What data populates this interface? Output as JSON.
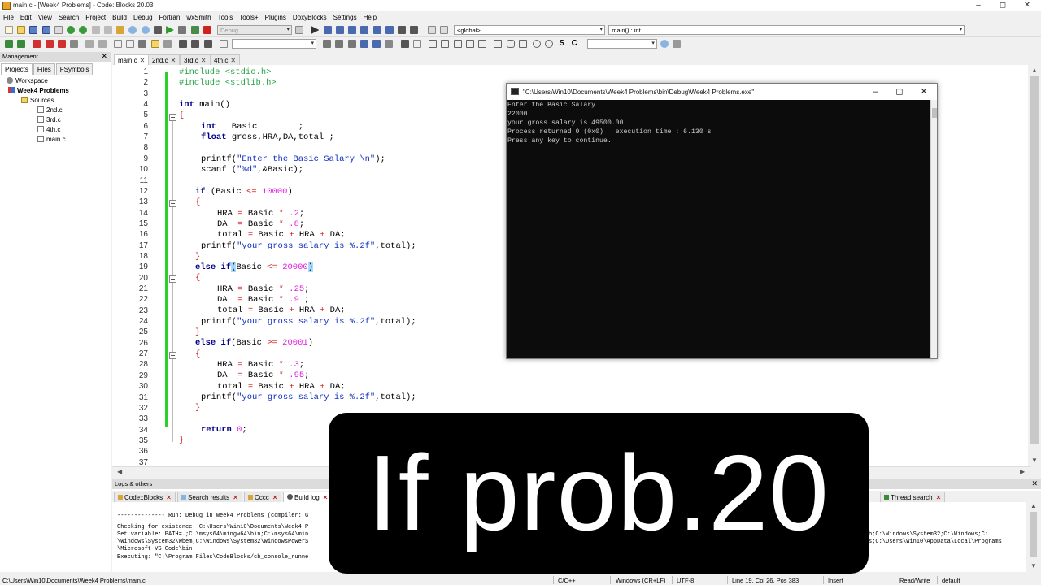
{
  "window": {
    "title": "main.c - [Week4 Problems] - Code::Blocks 20.03"
  },
  "menubar": [
    "File",
    "Edit",
    "View",
    "Search",
    "Project",
    "Build",
    "Debug",
    "Fortran",
    "wxSmith",
    "Tools",
    "Tools+",
    "Plugins",
    "DoxyBlocks",
    "Settings",
    "Help"
  ],
  "toolbar": {
    "build_target": "Debug",
    "scope": "<global>",
    "function": "main() : int"
  },
  "management": {
    "title": "Management",
    "tabs": [
      "Projects",
      "Files",
      "FSymbols"
    ],
    "workspace": "Workspace",
    "project": "Week4 Problems",
    "sources": "Sources",
    "files": [
      "2nd.c",
      "3rd.c",
      "4th.c",
      "main.c"
    ]
  },
  "editor": {
    "tabs": [
      {
        "label": "main.c",
        "active": true
      },
      {
        "label": "2nd.c",
        "active": false
      },
      {
        "label": "3rd.c",
        "active": false
      },
      {
        "label": "4th.c",
        "active": false
      }
    ],
    "line_numbers": [
      1,
      2,
      3,
      4,
      5,
      6,
      7,
      8,
      9,
      10,
      11,
      12,
      13,
      14,
      15,
      16,
      17,
      18,
      19,
      20,
      21,
      22,
      23,
      24,
      25,
      26,
      27,
      28,
      29,
      30,
      31,
      32,
      33,
      34,
      35,
      36,
      37
    ],
    "code": {
      "l1": "#include <stdio.h>",
      "l2": "#include <stdlib.h>",
      "l4a": "int",
      "l4b": " main()",
      "l5": "{",
      "l6a": "int",
      "l6b": "   Basic        ;",
      "l7a": "float",
      "l7b": " gross,HRA,DA,total ;",
      "l9a": "printf(",
      "l9b": "\"Enter the Basic Salary \\n\"",
      "l9c": ");",
      "l10a": "scanf (",
      "l10b": "\"%d\"",
      "l10c": ",&Basic);",
      "l12a": "if",
      "l12b": " (Basic ",
      "l12c": "<=",
      "l12d": " ",
      "l12e": "10000",
      "l12f": ")",
      "l13": "{",
      "l14a": "HRA ",
      "l14b": "=",
      "l14c": " Basic ",
      "l14d": "*",
      "l14e": " ",
      "l14f": ".2",
      "l14g": ";",
      "l15a": "DA  ",
      "l15b": "=",
      "l15c": " Basic ",
      "l15d": "*",
      "l15e": " ",
      "l15f": ".8",
      "l15g": ";",
      "l16a": "total ",
      "l16b": "=",
      "l16c": " Basic ",
      "l16d": "+",
      "l16e": " HRA ",
      "l16f": "+",
      "l16g": " DA;",
      "l17a": "printf(",
      "l17b": "\"your gross salary is %.2f\"",
      "l17c": ",total);",
      "l18": "}",
      "l19a": "else",
      "l19b": " ",
      "l19c": "if",
      "l19d": "(",
      "l19e": "Basic ",
      "l19f": "<=",
      "l19g": " ",
      "l19h": "20000",
      "l19i": ")",
      "l20": "{",
      "l21a": "HRA ",
      "l21b": "=",
      "l21c": " Basic ",
      "l21d": "*",
      "l21e": " ",
      "l21f": ".25",
      "l21g": ";",
      "l22a": "DA  ",
      "l22b": "=",
      "l22c": " Basic ",
      "l22d": "*",
      "l22e": " ",
      "l22f": ".9",
      "l22g": " ;",
      "l23a": "total ",
      "l23b": "=",
      "l23c": " Basic ",
      "l23d": "+",
      "l23e": " HRA ",
      "l23f": "+",
      "l23g": " DA;",
      "l24a": "printf(",
      "l24b": "\"your gross salary is %.2f\"",
      "l24c": ",total);",
      "l25": "}",
      "l26a": "else",
      "l26b": " ",
      "l26c": "if",
      "l26d": "(Basic ",
      "l26e": ">=",
      "l26f": " ",
      "l26g": "20001",
      "l26h": ")",
      "l27": "{",
      "l28a": "HRA ",
      "l28b": "=",
      "l28c": " Basic ",
      "l28d": "*",
      "l28e": " ",
      "l28f": ".3",
      "l28g": ";",
      "l29a": "DA  ",
      "l29b": "=",
      "l29c": " Basic ",
      "l29d": "*",
      "l29e": " ",
      "l29f": ".95",
      "l29g": ";",
      "l30a": "total ",
      "l30b": "=",
      "l30c": " Basic ",
      "l30d": "+",
      "l30e": " HRA ",
      "l30f": "+",
      "l30g": " DA;",
      "l31a": "printf(",
      "l31b": "\"your gross salary is %.2f\"",
      "l31c": ",total);",
      "l32": "}",
      "l34a": "return",
      "l34b": " ",
      "l34c": "0",
      "l34d": ";",
      "l35": "}"
    }
  },
  "console": {
    "title": "\"C:\\Users\\Win10\\Documents\\Week4 Problems\\bin\\Debug\\Week4 Problems.exe\"",
    "lines": [
      "Enter the Basic Salary",
      "22000",
      "your gross salary is 49500.00",
      "Process returned 0 (0x0)   execution time : 6.130 s",
      "Press any key to continue."
    ]
  },
  "logs": {
    "title": "Logs & others",
    "tabs": [
      {
        "label": "Code::Blocks",
        "active": false
      },
      {
        "label": "Search results",
        "active": false
      },
      {
        "label": "Cccc",
        "active": false
      },
      {
        "label": "Build log",
        "active": true
      },
      {
        "label": "Thread search",
        "active": false
      }
    ],
    "lines": [
      "-------------- Run: Debug in Week4 Problems (compiler: G",
      "Checking for existence: C:\\Users\\Win10\\Documents\\Week4 P",
      "Set variable: PATH=.;C:\\msys64\\mingw64\\bin;C:\\msys64\\min",
      "\\Windows\\System32\\Wbem;C:\\Windows\\System32\\WindowsPowerS",
      "\\Microsoft VS Code\\bin",
      "Executing: \"C:\\Program Files\\CodeBlocks/cb_console_runne"
    ],
    "right_lines": [
      "h;C:\\Windows\\System32;C:\\Windows;C:",
      "s;C:\\Users\\Win10\\AppData\\Local\\Programs"
    ]
  },
  "statusbar": {
    "path": "C:\\Users\\Win10\\Documents\\Week4 Problems\\main.c",
    "lang": "C/C++",
    "eol": "Windows (CR+LF)",
    "encoding": "UTF-8",
    "position": "Line 19, Col 26, Pos 383",
    "mode": "Insert",
    "rw": "Read/Write",
    "profile": "default"
  },
  "overlay": {
    "caption": "If prob.20"
  }
}
